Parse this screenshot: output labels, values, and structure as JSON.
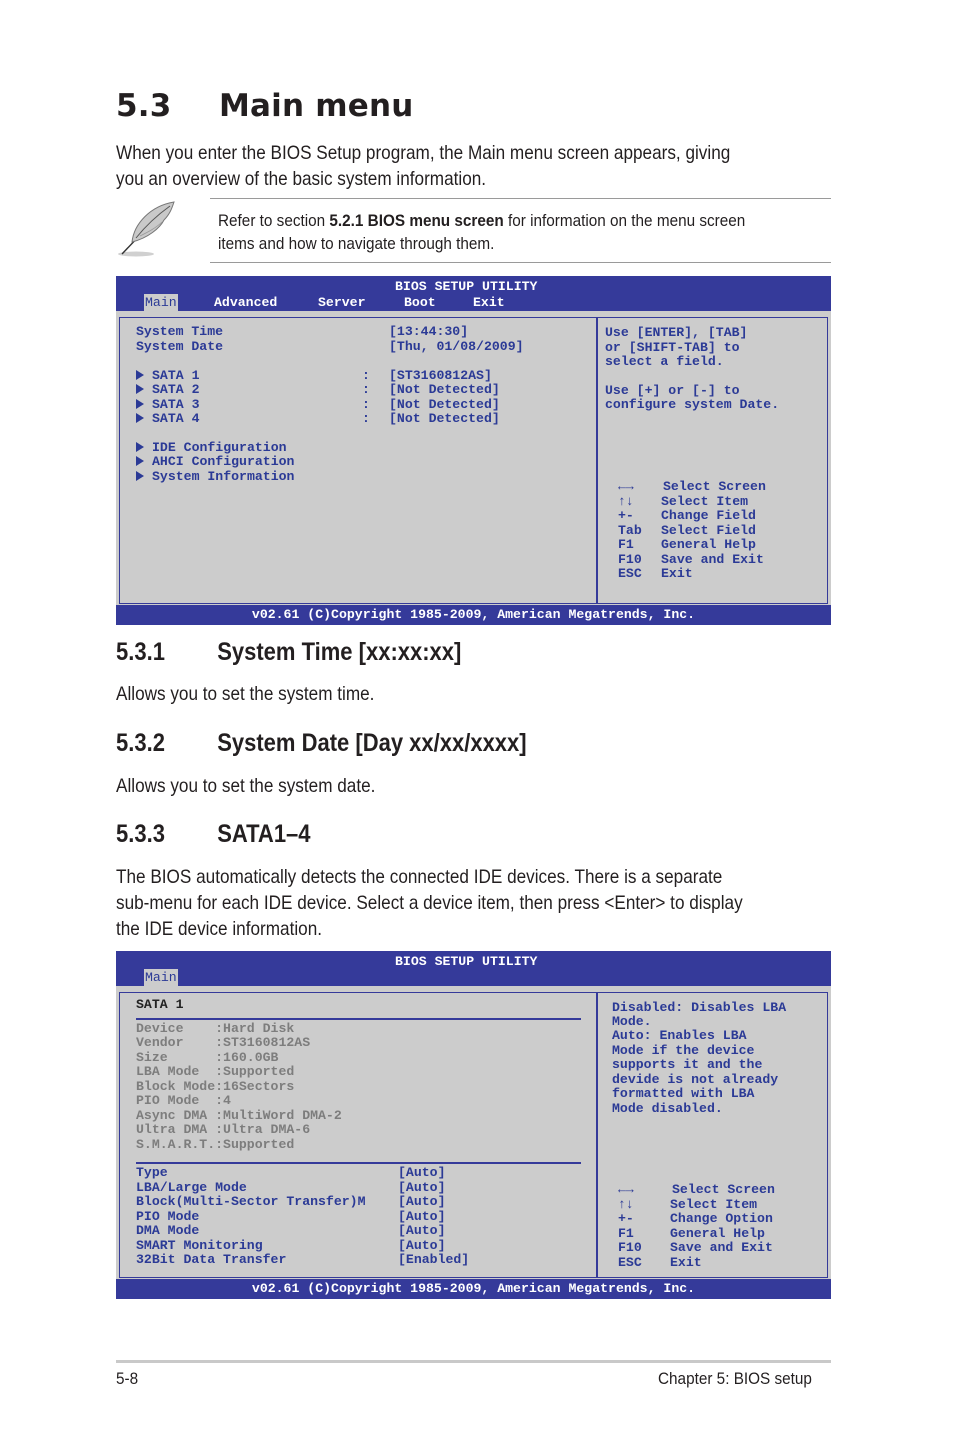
{
  "section": {
    "number": "5.3",
    "title": "Main menu",
    "intro_lines": [
      "When you enter the BIOS Setup program, the Main menu screen appears, giving",
      "you an overview of the basic system information."
    ]
  },
  "note": {
    "icon": "feather-pen-icon",
    "prefix": "Refer to section ",
    "bold": "5.2.1 BIOS menu screen",
    "suffix": " for information on the menu screen",
    "line2": "items and how to navigate through them."
  },
  "bios_main": {
    "title": "BIOS SETUP UTILITY",
    "tabs": [
      "Main",
      "Advanced",
      "Server",
      "Boot",
      "Exit"
    ],
    "active_tab": "Main",
    "items": [
      {
        "label": "System Time",
        "value": "[13:44:30]"
      },
      {
        "label": "System Date",
        "value": "[Thu, 01/08/2009]"
      }
    ],
    "sata": [
      {
        "label": "SATA 1",
        "sep": ":",
        "value": "[ST3160812AS]"
      },
      {
        "label": "SATA 2",
        "sep": ":",
        "value": "[Not Detected]"
      },
      {
        "label": "SATA 3",
        "sep": ":",
        "value": "[Not Detected]"
      },
      {
        "label": "SATA 4",
        "sep": ":",
        "value": "[Not Detected]"
      }
    ],
    "submenus": [
      "IDE Configuration",
      "AHCI Configuration",
      "System Information"
    ],
    "help_lines": [
      "Use [ENTER], [TAB]",
      "or [SHIFT-TAB] to",
      "select a field.",
      "",
      "Use [+] or [-] to",
      "configure system Date."
    ],
    "keys": [
      {
        "key": "←→",
        "action": "Select Screen"
      },
      {
        "key": "↑↓",
        "action": "Select Item"
      },
      {
        "key": "+-",
        "action": "Change Field"
      },
      {
        "key": "Tab",
        "action": "Select Field"
      },
      {
        "key": "F1",
        "action": "General Help"
      },
      {
        "key": "F10",
        "action": "Save and Exit"
      },
      {
        "key": "ESC",
        "action": "Exit"
      }
    ],
    "footer": "v02.61 (C)Copyright 1985-2009, American Megatrends, Inc."
  },
  "sub_531": {
    "number": "5.3.1",
    "title": "System Time [xx:xx:xx]",
    "text": "Allows you to set the system time."
  },
  "sub_532": {
    "number": "5.3.2",
    "title": "System Date [Day xx/xx/xxxx]",
    "text": "Allows you to set the system date."
  },
  "sub_533": {
    "number": "5.3.3",
    "title": "SATA1–4",
    "text_lines": [
      "The BIOS automatically detects the connected IDE devices. There is a separate",
      "sub-menu for each IDE device. Select a device item, then press <Enter> to display",
      "the IDE device information."
    ]
  },
  "bios_sata": {
    "title": "BIOS SETUP UTILITY",
    "active_tab": "Main",
    "heading": "SATA 1",
    "info": [
      {
        "label": "Device    ",
        "value": ":Hard Disk"
      },
      {
        "label": "Vendor    ",
        "value": ":ST3160812AS"
      },
      {
        "label": "Size      ",
        "value": ":160.0GB"
      },
      {
        "label": "LBA Mode  ",
        "value": ":Supported"
      },
      {
        "label": "Block Mode",
        "value": ":16Sectors"
      },
      {
        "label": "PIO Mode  ",
        "value": ":4"
      },
      {
        "label": "Async DMA ",
        "value": ":MultiWord DMA-2"
      },
      {
        "label": "Ultra DMA ",
        "value": ":Ultra DMA-6"
      },
      {
        "label": "S.M.A.R.T.",
        "value": ":Supported"
      }
    ],
    "settings": [
      {
        "label": "Type",
        "value": "[Auto]"
      },
      {
        "label": "LBA/Large Mode",
        "value": "[Auto]"
      },
      {
        "label": "Block(Multi-Sector Transfer)M",
        "value": "[Auto]"
      },
      {
        "label": "PIO Mode",
        "value": "[Auto]"
      },
      {
        "label": "DMA Mode",
        "value": "[Auto]"
      },
      {
        "label": "SMART Monitoring",
        "value": "[Auto]"
      },
      {
        "label": "32Bit Data Transfer",
        "value": "[Enabled]"
      }
    ],
    "help_lines": [
      "Disabled: Disables LBA",
      "Mode.",
      "Auto: Enables LBA",
      "Mode if the device",
      "supports it and the",
      "devide is not already",
      "formatted with LBA",
      "Mode disabled."
    ],
    "keys": [
      {
        "key": "←→",
        "action": "Select Screen"
      },
      {
        "key": "↑↓",
        "action": "Select Item"
      },
      {
        "key": "+-",
        "action": "Change Option"
      },
      {
        "key": "F1",
        "action": "General Help"
      },
      {
        "key": "F10",
        "action": "Save and Exit"
      },
      {
        "key": "ESC",
        "action": "Exit"
      }
    ],
    "footer": "v02.61 (C)Copyright 1985-2009, American Megatrends, Inc."
  },
  "page_footer": {
    "page_number": "5-8",
    "chapter": "Chapter 5: BIOS setup"
  },
  "colors": {
    "bios_blue": "#353a9a",
    "bios_text": "#2b3a96",
    "bios_bg": "#cccccc",
    "bios_gray_text": "#7d7d7d"
  }
}
